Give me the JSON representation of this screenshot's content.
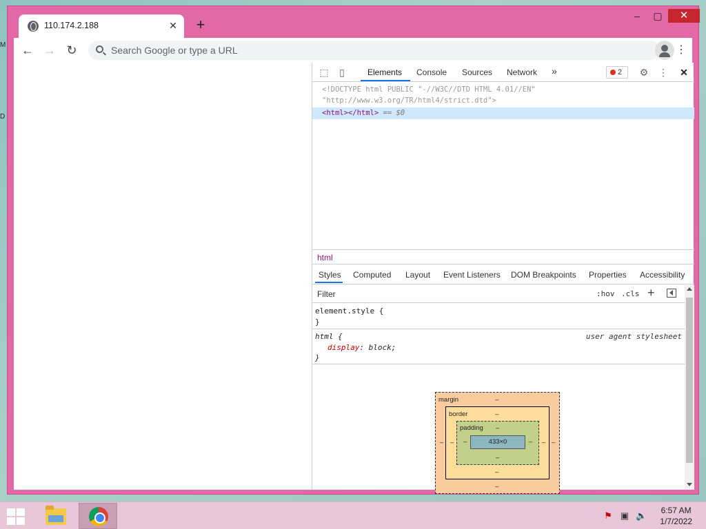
{
  "browser": {
    "tab_title": "110.174.2.188",
    "omnibox_placeholder": "Search Google or type a URL"
  },
  "devtools": {
    "tabs": [
      "Elements",
      "Console",
      "Sources",
      "Network"
    ],
    "more_tabs": "»",
    "error_count": "2",
    "dom": {
      "doctype_line1": "<!DOCTYPE html PUBLIC \"-//W3C//DTD HTML 4.01//EN\"",
      "doctype_line2": "\"http://www.w3.org/TR/html4/strict.dtd\">",
      "selected_tag": "<html></html>",
      "selected_suffix": " == $0"
    },
    "breadcrumb": "html",
    "subtabs": [
      "Styles",
      "Computed",
      "Layout",
      "Event Listeners",
      "DOM Breakpoints",
      "Properties",
      "Accessibility"
    ],
    "filter": {
      "placeholder": "Filter",
      "hov": ":hov",
      "cls": ".cls"
    },
    "rules": {
      "element_style_open": "element.style {",
      "element_style_close": "}",
      "html_selector": "html {",
      "ua_label": "user agent stylesheet",
      "property": "display",
      "value": "block;",
      "html_close": "}"
    },
    "box_model": {
      "margin_label": "margin",
      "border_label": "border",
      "padding_label": "padding",
      "content_size": "433×0",
      "dash": "–"
    }
  },
  "taskbar": {
    "time": "6:57 AM",
    "date": "1/7/2022"
  }
}
